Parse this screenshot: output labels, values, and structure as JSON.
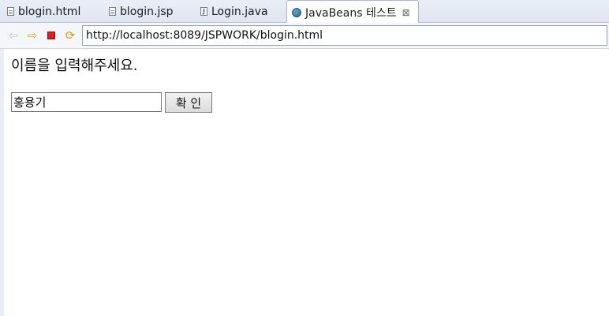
{
  "tabs": [
    {
      "label": "blogin.html",
      "icon": "file-icon",
      "active": false
    },
    {
      "label": "blogin.jsp",
      "icon": "file-icon",
      "active": false
    },
    {
      "label": "Login.java",
      "icon": "java-file-icon",
      "active": false
    },
    {
      "label": "JavaBeans 테스트",
      "icon": "globe-icon",
      "active": true,
      "close": "⊠"
    }
  ],
  "nav": {
    "back_icon": "back-arrow-icon",
    "forward_icon": "forward-arrow-icon",
    "stop_icon": "stop-icon",
    "refresh_icon": "refresh-icon",
    "url": "http://localhost:8089/JSPWORK/blogin.html"
  },
  "page": {
    "prompt": "이름을 입력해주세요.",
    "name_value": "홍용기",
    "confirm_label": "확 인"
  },
  "colors": {
    "tabbar_bg": "#e2e8f2",
    "stop_red": "#d62020",
    "forward_orange": "#e0a21b"
  }
}
